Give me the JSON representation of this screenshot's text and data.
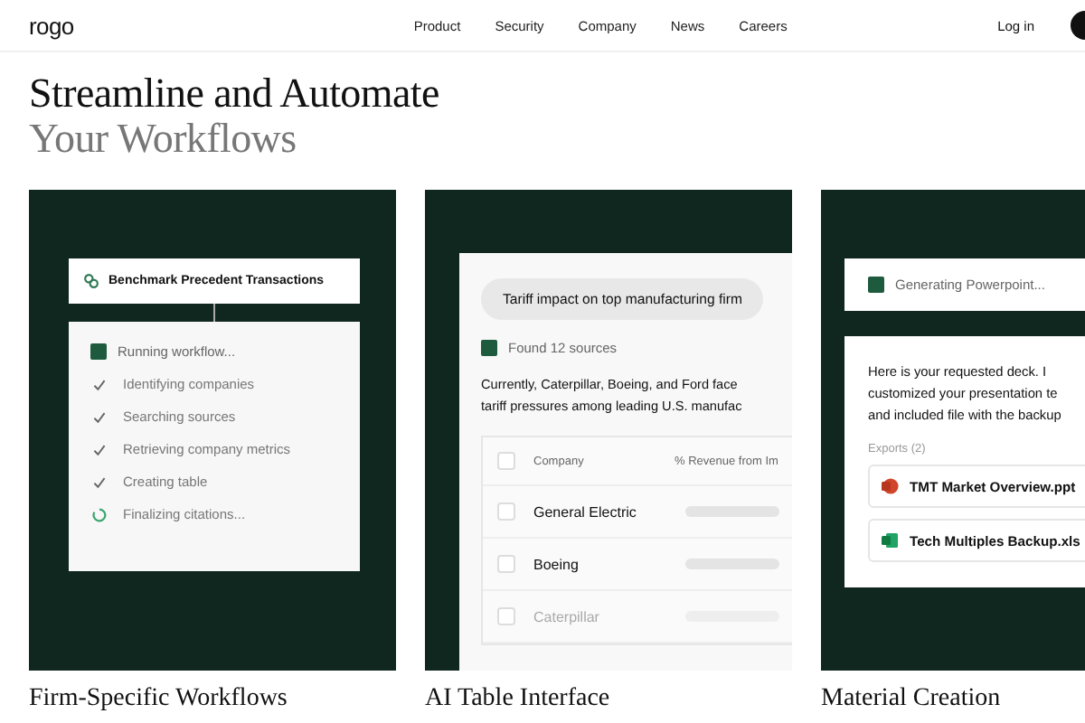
{
  "nav": {
    "logo": "rogo",
    "links": [
      "Product",
      "Security",
      "Company",
      "News",
      "Careers"
    ],
    "login": "Log in"
  },
  "heading": {
    "line1": "Streamline and Automate",
    "line2": "Your Workflows"
  },
  "cards": [
    {
      "kind": "workflow",
      "caption": "Firm-Specific Workflows",
      "title": "Benchmark Precedent Transactions",
      "status": "Running workflow...",
      "steps": [
        {
          "label": "Identifying companies",
          "done": true
        },
        {
          "label": "Searching sources",
          "done": true
        },
        {
          "label": "Retrieving company metrics",
          "done": true
        },
        {
          "label": "Creating table",
          "done": true
        },
        {
          "label": "Finalizing citations...",
          "done": false
        }
      ]
    },
    {
      "kind": "table",
      "caption": "AI Table Interface",
      "query": "Tariff impact on top manufacturing firm",
      "status": "Found 12 sources",
      "lines": [
        "Currently, Caterpillar, Boeing, and Ford face",
        "tariff pressures among leading U.S. manufac"
      ],
      "columns": [
        "Company",
        "% Revenue from Im"
      ],
      "header_checked": false,
      "rows": [
        {
          "company": "General Electric",
          "checked": false,
          "dimmed": false
        },
        {
          "company": "Boeing",
          "checked": false,
          "dimmed": false
        },
        {
          "company": "Caterpillar",
          "checked": false,
          "dimmed": true
        }
      ]
    },
    {
      "kind": "deck",
      "caption": "Material Creation",
      "status": "Generating Powerpoint...",
      "lines": [
        "Here is your requested deck. I",
        "customized your presentation te",
        "and included file with the backup"
      ],
      "exports_label": "Exports (2)",
      "files": [
        {
          "name": "TMT Market Overview.ppt",
          "kind": "ppt"
        },
        {
          "name": "Tech Multiples Backup.xls",
          "kind": "xls"
        }
      ]
    }
  ]
}
